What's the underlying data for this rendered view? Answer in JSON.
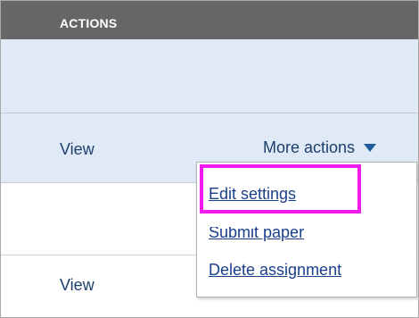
{
  "header": {
    "title": "ACTIONS"
  },
  "rows": [
    {
      "view_label": "View",
      "more_actions_label": "More actions"
    },
    {
      "view_label": "View"
    }
  ],
  "menu": {
    "items": [
      {
        "label": "Edit settings"
      },
      {
        "label": "Submit paper"
      },
      {
        "label": "Delete assignment"
      }
    ]
  },
  "colors": {
    "header_bg": "#666666",
    "row_bg": "#e0e9f6",
    "link": "#1a3f8a",
    "highlight": "#f21aed"
  }
}
